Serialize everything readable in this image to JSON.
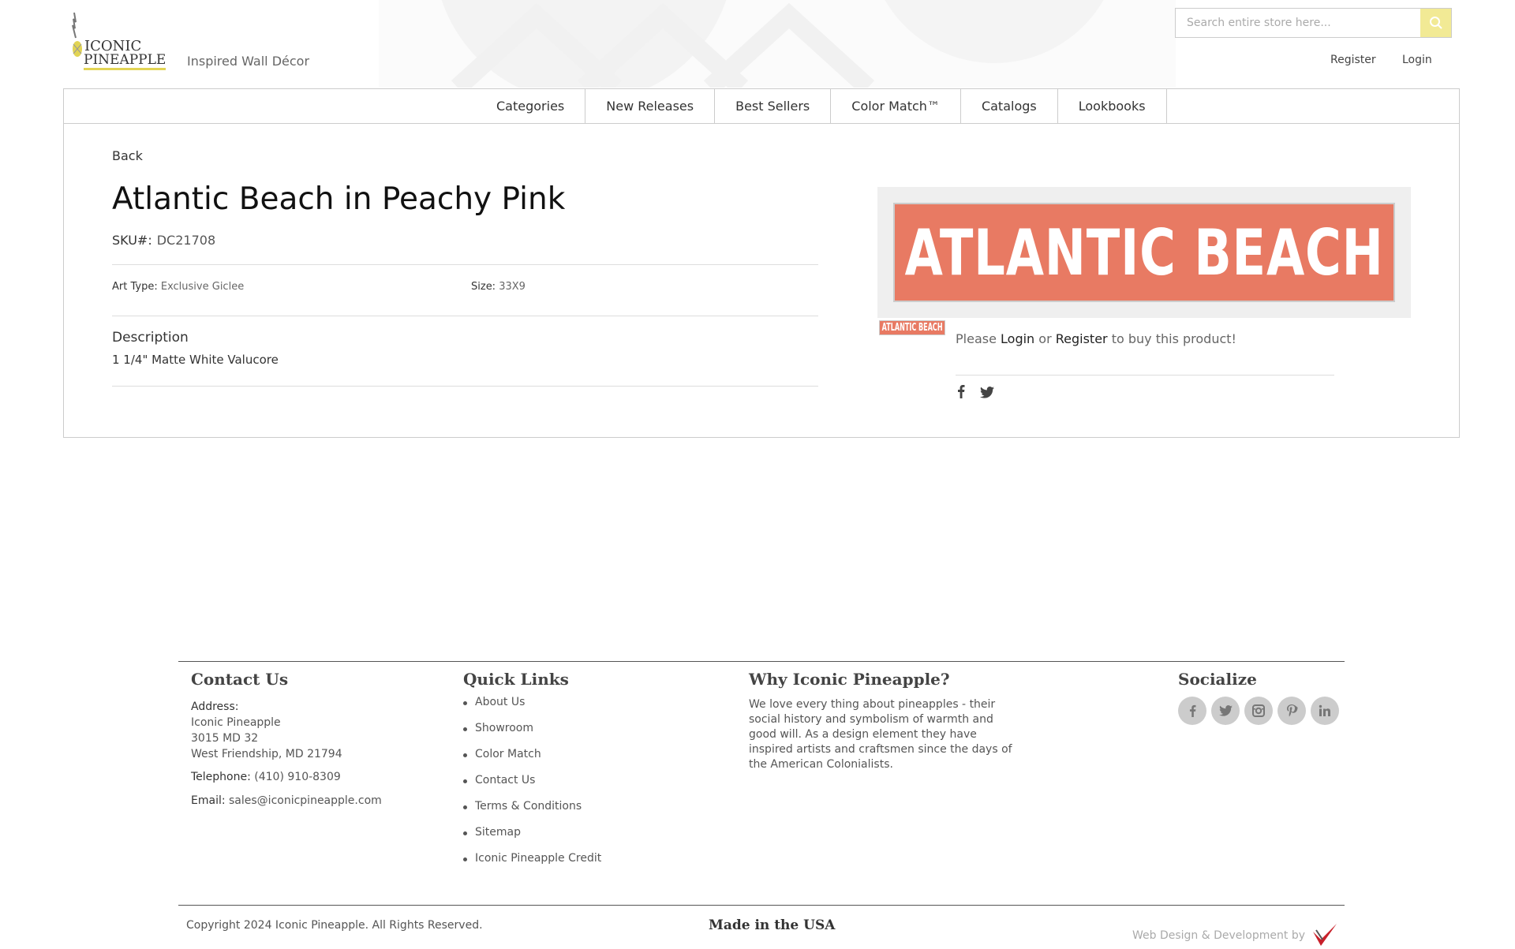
{
  "header": {
    "logo_line1": "ICONIC",
    "logo_line2": "PINEAPPLE",
    "tagline": "Inspired Wall Décor",
    "search": {
      "placeholder": "Search entire store here..."
    },
    "register_label": "Register",
    "login_label": "Login"
  },
  "nav": {
    "items": [
      "Categories",
      "New Releases",
      "Best Sellers",
      "Color Match™",
      "Catalogs",
      "Lookbooks"
    ]
  },
  "product": {
    "back_label": "Back",
    "title": "Atlantic Beach in Peachy Pink",
    "sku_label": "SKU#:",
    "sku": "DC21708",
    "art_type_label": "Art Type:",
    "art_type": "Exclusive Giclee",
    "size_label": "Size:",
    "size": "33X9",
    "description_heading": "Description",
    "description": "1 1/4\" Matte White Valucore",
    "image_text": "ATLANTIC BEACH",
    "thumb_text": "ATLANTIC BEACH",
    "buy_prefix": "Please",
    "buy_login": "Login",
    "buy_or": "or",
    "buy_register": "Register",
    "buy_suffix": "to buy this product!",
    "image_color": "#e87a63"
  },
  "footer": {
    "contact": {
      "heading": "Contact Us",
      "address_label": "Address:",
      "address_line1": "Iconic Pineapple",
      "address_line2": "3015 MD 32",
      "address_line3": "West Friendship, MD 21794",
      "telephone_label": "Telephone:",
      "telephone": "(410) 910-8309",
      "email_label": "Email:",
      "email": "sales@iconicpineapple.com"
    },
    "quick_links": {
      "heading": "Quick Links",
      "items": [
        "About Us",
        "Showroom",
        "Color Match",
        "Contact Us",
        "Terms & Conditions",
        "Sitemap",
        "Iconic Pineapple Credit"
      ]
    },
    "why": {
      "heading": "Why Iconic Pineapple?",
      "text": "We love every thing about pineapples - their social history and symbolism of warmth and good will. As a design element they have inspired artists and craftsmen since the days of the American Colonialists."
    },
    "socialize": {
      "heading": "Socialize",
      "icons": [
        "facebook-icon",
        "twitter-icon",
        "instagram-icon",
        "pinterest-icon",
        "linkedin-icon"
      ]
    },
    "copyright": "Copyright 2024 Iconic Pineapple. All Rights Reserved.",
    "made_in": "Made in the USA",
    "credit": "Web Design & Development by"
  },
  "colors": {
    "accent": "#f2ea95",
    "logo_underline": "#e2d454",
    "product": "#e87a63"
  }
}
